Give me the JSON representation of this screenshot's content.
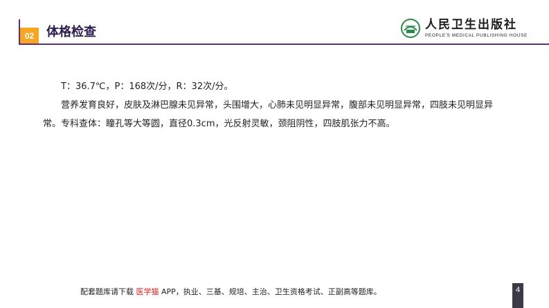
{
  "header": {
    "section_number": "02",
    "title": "体格检查"
  },
  "logo": {
    "name_cn": "人民卫生出版社",
    "name_en": "PEOPLE'S MEDICAL PUBLISHING HOUSE",
    "icon": "publisher-logo-icon"
  },
  "content": {
    "vitals": "T：36.7℃，P：168次/分，R：32次/分。",
    "exam": "营养发育良好，皮肤及淋巴腺未见异常，头围增大，心肺未见明显异常，腹部未见明显异常，四肢未见明显异常。专科查体：瞳孔等大等圆，直径0.3cm，光反射灵敏，颈阻阴性，四肢肌张力不高。"
  },
  "footer": {
    "prefix": "配套题库请下载 ",
    "highlight": "医学猫",
    "suffix": " APP，执业、三基、规培、主治、卫生资格考试、正副高等题库。"
  },
  "page_number": "4",
  "colors": {
    "header_line": "#5a2d82",
    "badge": "#f6a623",
    "title": "#2d1b4e",
    "footer_highlight": "#e02020",
    "page_box": "#3b3b46"
  }
}
